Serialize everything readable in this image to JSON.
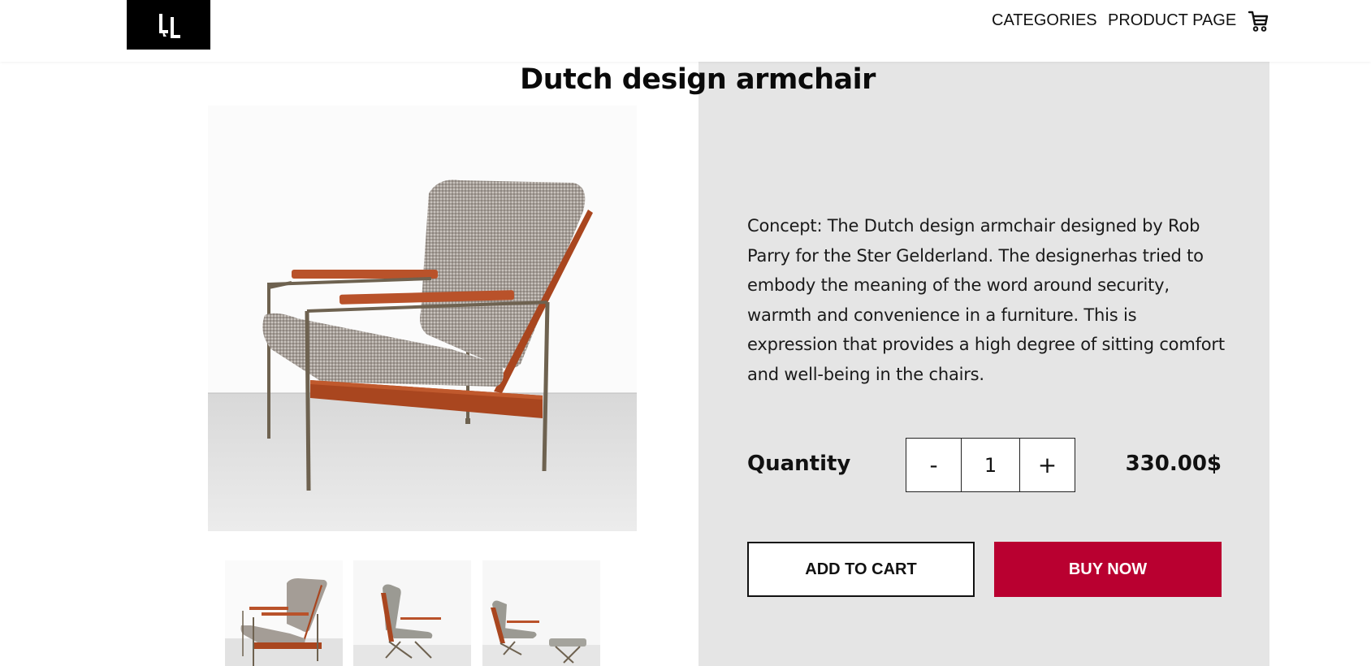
{
  "header": {
    "logo_text": "LL",
    "nav": [
      {
        "label": "CATEGORIES"
      },
      {
        "label": "PRODUCT PAGE"
      }
    ],
    "cart_icon": "shopping-cart-icon"
  },
  "product": {
    "title": "Dutch design armchair",
    "description": "Concept: The Dutch design armchair designed by Rob Parry for the Ster Gelderland. The designerhas tried to embody the meaning of the word around security, warmth and convenience in a furniture. This is expression that provides a high degree of sitting comfort and well-being in the chairs.",
    "quantity_label": "Quantity",
    "quantity": "1",
    "decrement": "-",
    "increment": "+",
    "price": "330.00$",
    "add_to_cart": "ADD TO CART",
    "buy_now": "BUY NOW"
  },
  "colors": {
    "accent": "#b90030",
    "panel": "#e5e5e5"
  }
}
